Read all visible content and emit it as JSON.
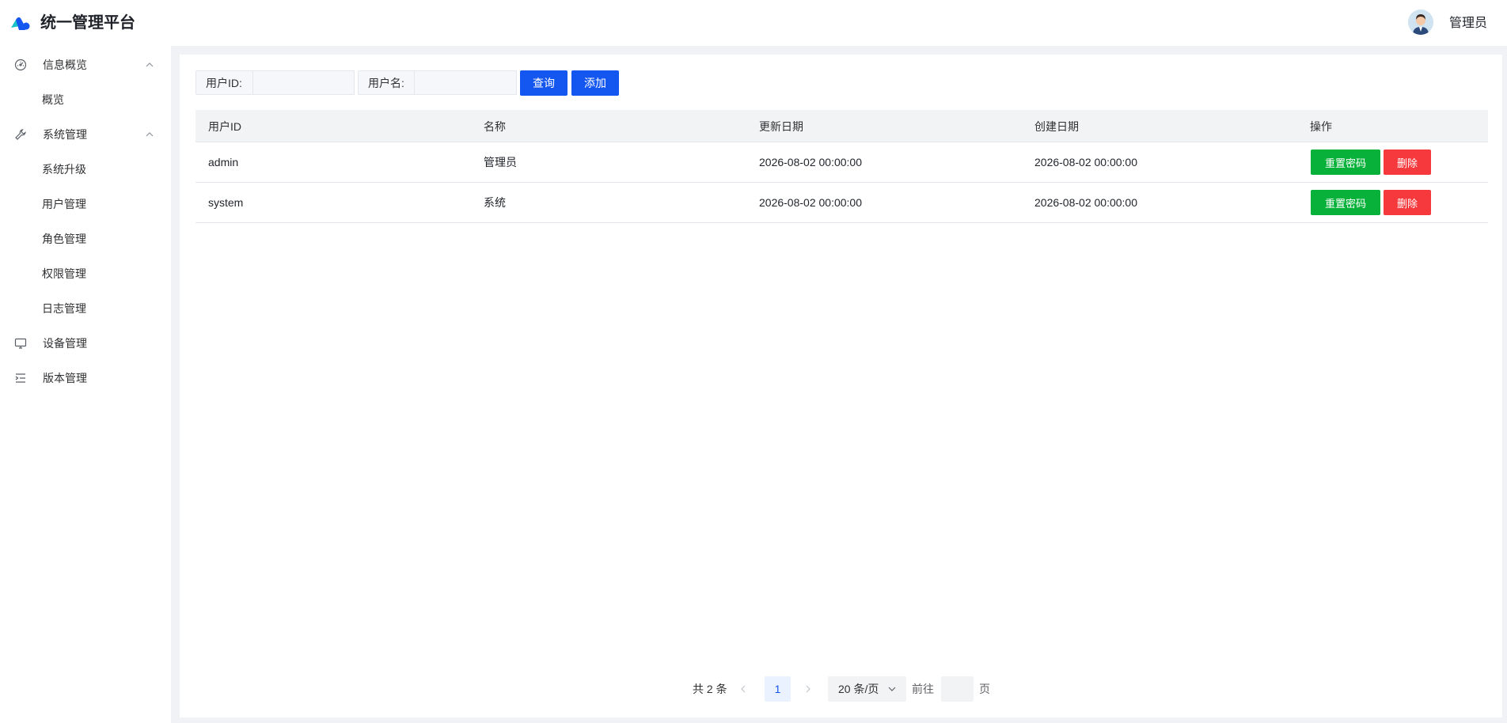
{
  "app": {
    "title": "统一管理平台",
    "user_name": "管理员"
  },
  "sidebar": {
    "groups": [
      {
        "label": "信息概览",
        "icon": "dashboard-icon",
        "expanded": true,
        "items": [
          {
            "label": "概览"
          }
        ]
      },
      {
        "label": "系统管理",
        "icon": "wrench-icon",
        "expanded": true,
        "items": [
          {
            "label": "系统升级"
          },
          {
            "label": "用户管理"
          },
          {
            "label": "角色管理"
          },
          {
            "label": "权限管理"
          },
          {
            "label": "日志管理"
          }
        ]
      },
      {
        "label": "设备管理",
        "icon": "monitor-icon"
      },
      {
        "label": "版本管理",
        "icon": "list-indent-icon"
      }
    ]
  },
  "search": {
    "user_id_label": "用户ID:",
    "user_id_value": "",
    "username_label": "用户名:",
    "username_value": "",
    "query_button": "查询",
    "add_button": "添加"
  },
  "table": {
    "columns": [
      "用户ID",
      "名称",
      "更新日期",
      "创建日期",
      "操作"
    ],
    "rows": [
      {
        "user_id": "admin",
        "name": "管理员",
        "updated": "2026-08-02 00:00:00",
        "created": "2026-08-02 00:00:00"
      },
      {
        "user_id": "system",
        "name": "系统",
        "updated": "2026-08-02 00:00:00",
        "created": "2026-08-02 00:00:00"
      }
    ],
    "reset_password_label": "重置密码",
    "delete_label": "删除"
  },
  "pagination": {
    "total_text": "共 2 条",
    "current_page": "1",
    "page_size": "20 条/页",
    "goto_prefix": "前往",
    "goto_value": "",
    "goto_suffix": "页"
  },
  "colors": {
    "primary": "#1456f0",
    "success": "#08b23a",
    "danger": "#f5393d",
    "background": "#f0f2f5"
  }
}
